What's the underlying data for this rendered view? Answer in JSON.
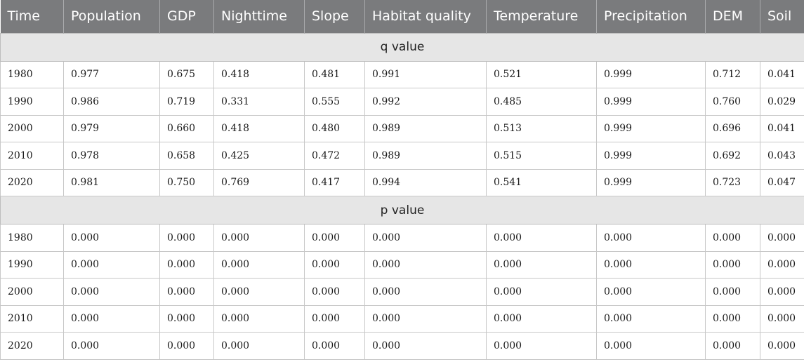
{
  "table": {
    "headers": [
      "Time",
      "Population",
      "GDP",
      "Nighttime",
      "Slope",
      "Habitat quality",
      "Temperature",
      "Precipitation",
      "DEM",
      "Soil"
    ],
    "sections": [
      {
        "label": "q value",
        "rows": [
          [
            "1980",
            "0.977",
            "0.675",
            "0.418",
            "0.481",
            "0.991",
            "0.521",
            "0.999",
            "0.712",
            "0.041"
          ],
          [
            "1990",
            "0.986",
            "0.719",
            "0.331",
            "0.555",
            "0.992",
            "0.485",
            "0.999",
            "0.760",
            "0.029"
          ],
          [
            "2000",
            "0.979",
            "0.660",
            "0.418",
            "0.480",
            "0.989",
            "0.513",
            "0.999",
            "0.696",
            "0.041"
          ],
          [
            "2010",
            "0.978",
            "0.658",
            "0.425",
            "0.472",
            "0.989",
            "0.515",
            "0.999",
            "0.692",
            "0.043"
          ],
          [
            "2020",
            "0.981",
            "0.750",
            "0.769",
            "0.417",
            "0.994",
            "0.541",
            "0.999",
            "0.723",
            "0.047"
          ]
        ]
      },
      {
        "label": "p value",
        "rows": [
          [
            "1980",
            "0.000",
            "0.000",
            "0.000",
            "0.000",
            "0.000",
            "0.000",
            "0.000",
            "0.000",
            "0.000"
          ],
          [
            "1990",
            "0.000",
            "0.000",
            "0.000",
            "0.000",
            "0.000",
            "0.000",
            "0.000",
            "0.000",
            "0.000"
          ],
          [
            "2000",
            "0.000",
            "0.000",
            "0.000",
            "0.000",
            "0.000",
            "0.000",
            "0.000",
            "0.000",
            "0.000"
          ],
          [
            "2010",
            "0.000",
            "0.000",
            "0.000",
            "0.000",
            "0.000",
            "0.000",
            "0.000",
            "0.000",
            "0.000"
          ],
          [
            "2020",
            "0.000",
            "0.000",
            "0.000",
            "0.000",
            "0.000",
            "0.000",
            "0.000",
            "0.000",
            "0.000"
          ]
        ]
      }
    ]
  }
}
